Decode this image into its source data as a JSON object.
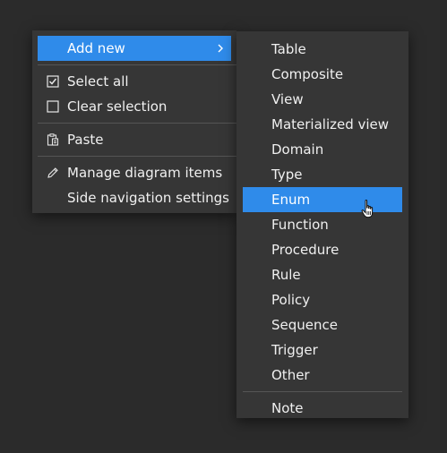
{
  "main_menu": {
    "add_new": "Add new",
    "select_all": "Select all",
    "clear_selection": "Clear selection",
    "paste": "Paste",
    "manage_diagram_items": "Manage diagram items",
    "side_navigation_settings": "Side navigation settings"
  },
  "submenu": {
    "items": [
      "Table",
      "Composite",
      "View",
      "Materialized view",
      "Domain",
      "Type",
      "Enum",
      "Function",
      "Procedure",
      "Rule",
      "Policy",
      "Sequence",
      "Trigger",
      "Other"
    ],
    "note": "Note"
  },
  "icons": {
    "add_new": "chevron-right-icon",
    "select_all": "checked-checkbox-icon",
    "clear_selection": "empty-checkbox-icon",
    "paste": "paste-icon",
    "manage_diagram_items": "pencil-icon",
    "cursor": "hand-pointer-icon"
  },
  "colors": {
    "background": "#2b2b2b",
    "menu_bg": "#363636",
    "highlight": "#2f8bea",
    "text": "#f0f0f0",
    "separator": "#555555"
  },
  "state": {
    "highlighted_main": "Add new",
    "hovered_submenu": "Enum"
  }
}
